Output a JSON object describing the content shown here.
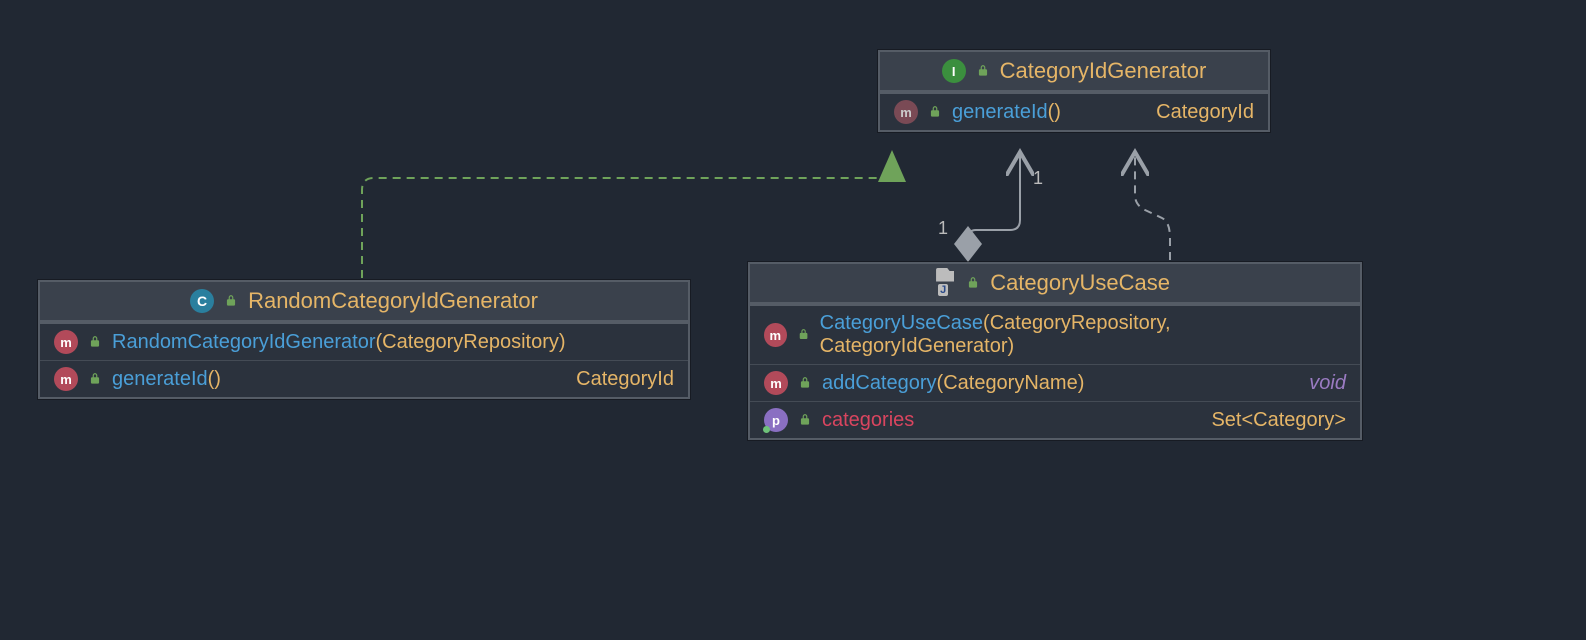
{
  "classes": {
    "cig": {
      "kind": "I",
      "title": "CategoryIdGenerator",
      "members": [
        {
          "kind": "m-impl",
          "name": "generateId",
          "params": "()",
          "ret": "CategoryId"
        }
      ]
    },
    "rcig": {
      "kind": "c",
      "title": "RandomCategoryIdGenerator",
      "members": [
        {
          "kind": "m",
          "name": "RandomCategoryIdGenerator",
          "params": "(CategoryRepository)",
          "ret": ""
        },
        {
          "kind": "m",
          "name": "generateId",
          "params": "()",
          "ret": "CategoryId"
        }
      ]
    },
    "cuc": {
      "kind": "J",
      "title": "CategoryUseCase",
      "members": [
        {
          "kind": "m",
          "name": "CategoryUseCase",
          "params": "(CategoryRepository, CategoryIdGenerator)",
          "ret": ""
        },
        {
          "kind": "m",
          "name": "addCategory",
          "params": "(CategoryName)",
          "ret": "void",
          "void": true
        },
        {
          "kind": "p",
          "prop": "categories",
          "ret": "Set<Category>"
        }
      ]
    }
  },
  "multiplicity": {
    "a": "1",
    "b": "1"
  },
  "relations": [
    {
      "type": "realization",
      "from": "rcig",
      "to": "cig"
    },
    {
      "type": "aggregation",
      "from": "cuc",
      "to": "cig",
      "mult": [
        "1",
        "1"
      ]
    },
    {
      "type": "dependency",
      "from": "cuc",
      "to": "cig"
    }
  ]
}
